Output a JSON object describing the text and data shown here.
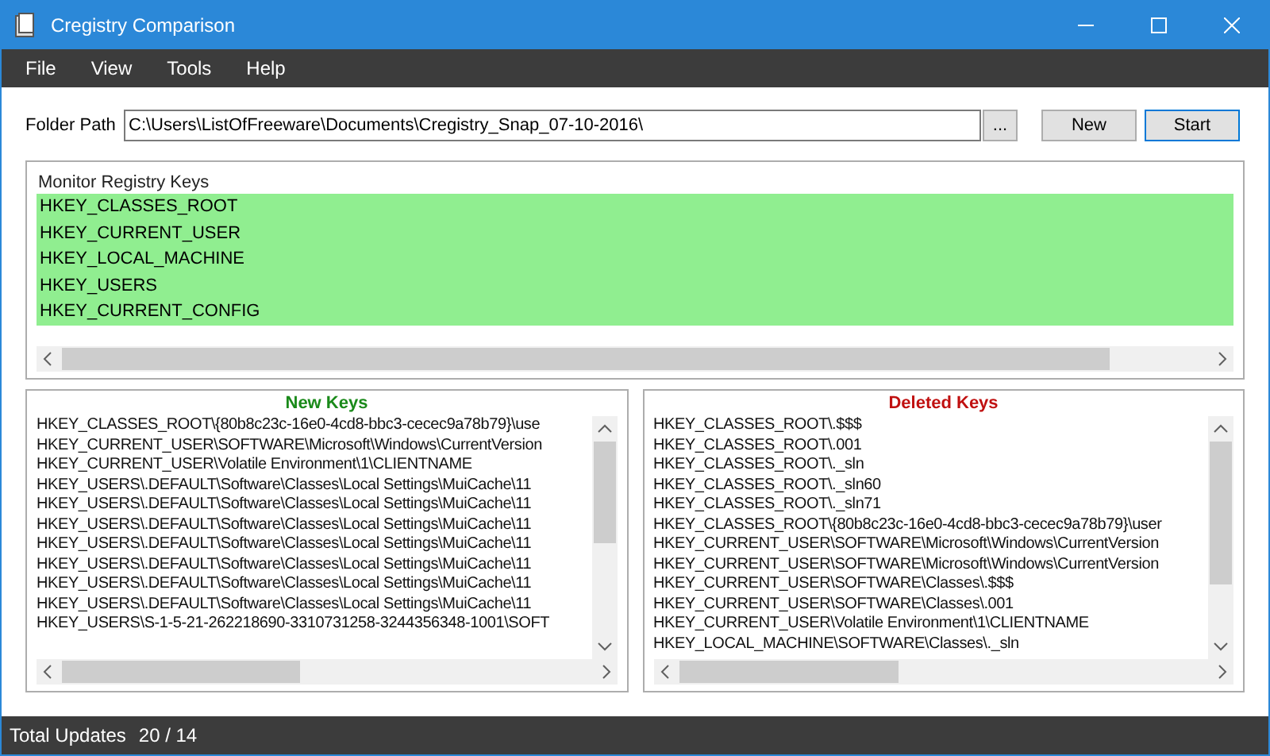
{
  "window": {
    "title": "Cregistry Comparison"
  },
  "menu": [
    "File",
    "View",
    "Tools",
    "Help"
  ],
  "folder_path": {
    "label": "Folder Path",
    "value": "C:\\Users\\ListOfFreeware\\Documents\\Cregistry_Snap_07-10-2016\\",
    "browse": "...",
    "buttons": [
      "New",
      "Start"
    ]
  },
  "monitor": {
    "title": "Monitor Registry Keys",
    "items": [
      {
        "label": "HKEY_CLASSES_ROOT",
        "selected": true
      },
      {
        "label": "HKEY_CURRENT_USER",
        "selected": true
      },
      {
        "label": "HKEY_LOCAL_MACHINE",
        "selected": true
      },
      {
        "label": "HKEY_USERS",
        "selected": true
      },
      {
        "label": "HKEY_CURRENT_CONFIG",
        "selected": true
      }
    ]
  },
  "lists": [
    {
      "title": "New Keys",
      "color": "#1a8a1a",
      "rows": [
        "HKEY_CLASSES_ROOT\\{80b8c23c-16e0-4cd8-bbc3-cecec9a78b79}\\use",
        "HKEY_CURRENT_USER\\SOFTWARE\\Microsoft\\Windows\\CurrentVersion",
        "HKEY_CURRENT_USER\\Volatile Environment\\1\\CLIENTNAME",
        "HKEY_USERS\\.DEFAULT\\Software\\Classes\\Local Settings\\MuiCache\\11",
        "HKEY_USERS\\.DEFAULT\\Software\\Classes\\Local Settings\\MuiCache\\11",
        "HKEY_USERS\\.DEFAULT\\Software\\Classes\\Local Settings\\MuiCache\\11",
        "HKEY_USERS\\.DEFAULT\\Software\\Classes\\Local Settings\\MuiCache\\11",
        "HKEY_USERS\\.DEFAULT\\Software\\Classes\\Local Settings\\MuiCache\\11",
        "HKEY_USERS\\.DEFAULT\\Software\\Classes\\Local Settings\\MuiCache\\11",
        "HKEY_USERS\\.DEFAULT\\Software\\Classes\\Local Settings\\MuiCache\\11",
        "HKEY_USERS\\S-1-5-21-262218690-3310731258-3244356348-1001\\SOFT"
      ]
    },
    {
      "title": "Deleted Keys",
      "color": "#c01010",
      "rows": [
        "HKEY_CLASSES_ROOT\\.$$$",
        "HKEY_CLASSES_ROOT\\.001",
        "HKEY_CLASSES_ROOT\\._sln",
        "HKEY_CLASSES_ROOT\\._sln60",
        "HKEY_CLASSES_ROOT\\._sln71",
        "HKEY_CLASSES_ROOT\\{80b8c23c-16e0-4cd8-bbc3-cecec9a78b79}\\user",
        "HKEY_CURRENT_USER\\SOFTWARE\\Microsoft\\Windows\\CurrentVersion",
        "HKEY_CURRENT_USER\\SOFTWARE\\Microsoft\\Windows\\CurrentVersion",
        "HKEY_CURRENT_USER\\SOFTWARE\\Classes\\.$$$",
        "HKEY_CURRENT_USER\\SOFTWARE\\Classes\\.001",
        "HKEY_CURRENT_USER\\Volatile Environment\\1\\CLIENTNAME",
        "HKEY_LOCAL_MACHINE\\SOFTWARE\\Classes\\._sln"
      ]
    }
  ],
  "status_bar": {
    "label": "Total Updates",
    "value": "20 / 14"
  }
}
